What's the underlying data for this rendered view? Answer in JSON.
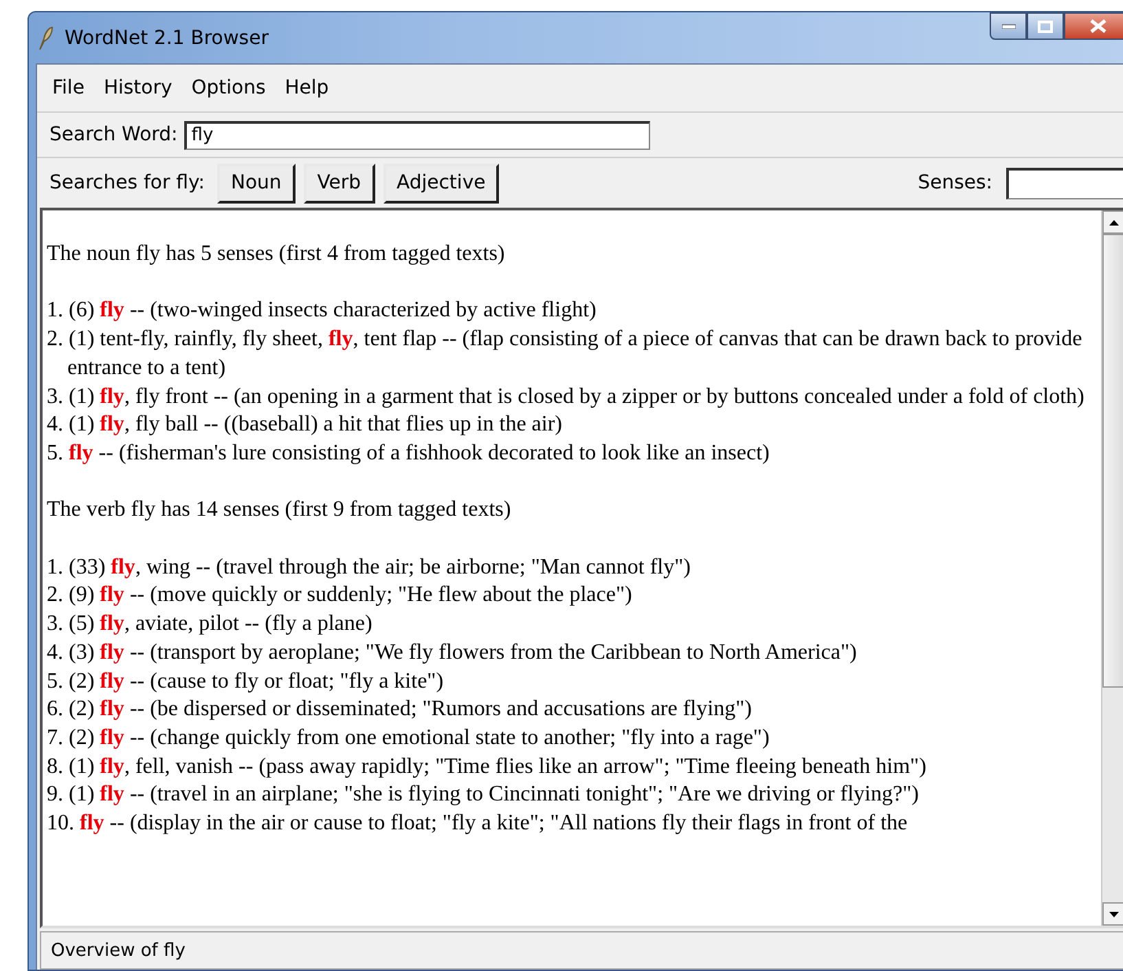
{
  "window": {
    "title": "WordNet 2.1 Browser"
  },
  "menu": [
    {
      "label": "File"
    },
    {
      "label": "History"
    },
    {
      "label": "Options"
    },
    {
      "label": "Help"
    }
  ],
  "search": {
    "label": "Search Word:",
    "value": "fly"
  },
  "searches": {
    "label": "Searches for fly:",
    "buttons": [
      "Noun",
      "Verb",
      "Adjective"
    ],
    "senses_label": "Senses:"
  },
  "results": [
    {
      "kind": "heading",
      "text": "The noun fly has 5 senses (first 4 from tagged texts)"
    },
    {
      "kind": "sense",
      "text": "1. (6) **fly** -- (two-winged insects characterized by active flight)"
    },
    {
      "kind": "sense",
      "text": "2. (1) tent-fly, rainfly, fly sheet, **fly**, tent flap -- (flap consisting of a piece of canvas that can be drawn back to provide entrance to a tent)"
    },
    {
      "kind": "sense",
      "text": "3. (1) **fly**, fly front -- (an opening in a garment that is closed by a zipper or by buttons concealed under a fold of cloth)"
    },
    {
      "kind": "sense",
      "text": "4. (1) **fly**, fly ball -- ((baseball) a hit that flies up in the air)"
    },
    {
      "kind": "sense",
      "text": "5. **fly** -- (fisherman's lure consisting of a fishhook decorated to look like an insect)"
    },
    {
      "kind": "heading",
      "text": "The verb fly has 14 senses (first 9 from tagged texts)"
    },
    {
      "kind": "sense",
      "text": "1. (33) **fly**, wing -- (travel through the air; be airborne; \"Man cannot fly\")"
    },
    {
      "kind": "sense",
      "text": "2. (9) **fly** -- (move quickly or suddenly; \"He flew about the place\")"
    },
    {
      "kind": "sense",
      "text": "3. (5) **fly**, aviate, pilot -- (fly a plane)"
    },
    {
      "kind": "sense",
      "text": "4. (3) **fly** -- (transport by aeroplane; \"We fly flowers from the Caribbean to North America\")"
    },
    {
      "kind": "sense",
      "text": "5. (2) **fly** -- (cause to fly or float; \"fly a kite\")"
    },
    {
      "kind": "sense",
      "text": "6. (2) **fly** -- (be dispersed or disseminated; \"Rumors and accusations are flying\")"
    },
    {
      "kind": "sense",
      "text": "7. (2) **fly** -- (change quickly from one emotional state to another; \"fly into a rage\")"
    },
    {
      "kind": "sense",
      "text": "8. (1) **fly**, fell, vanish -- (pass away rapidly; \"Time flies like an arrow\"; \"Time fleeing beneath him\")"
    },
    {
      "kind": "sense",
      "text": "9. (1) **fly** -- (travel in an airplane; \"she is flying to Cincinnati tonight\"; \"Are we driving or flying?\")"
    },
    {
      "kind": "sense",
      "text": "10. **fly** -- (display in the air or cause to float; \"fly a kite\"; \"All nations fly their flags in front of the"
    }
  ],
  "status_bar": "Overview of fly"
}
